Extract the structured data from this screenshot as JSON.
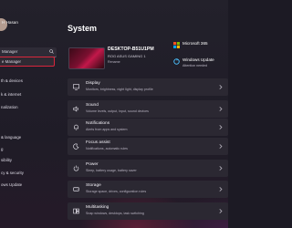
{
  "user": {
    "name": "H Hasan",
    "email": ""
  },
  "search": {
    "value": "Manager"
  },
  "sidebar": {
    "items": [
      {
        "label": "e Manager",
        "active": true
      },
      {
        "label": "th & devices"
      },
      {
        "label": "k & internet"
      },
      {
        "label": "nalization"
      },
      {
        "label": ""
      },
      {
        "label": ""
      },
      {
        "label": "& language"
      },
      {
        "label": "g"
      },
      {
        "label": "sibility"
      },
      {
        "label": "cy & security"
      },
      {
        "label": "ows Update"
      }
    ]
  },
  "main": {
    "title": "System",
    "device": {
      "name": "DESKTOP-B51U1PM",
      "model": "ROG ASUS GAMING 1",
      "rename": "Rename"
    },
    "quick_links": [
      {
        "title": "Microsoft 365",
        "sub": "",
        "icon": "microsoft365-icon"
      },
      {
        "title": "Windows Update",
        "sub": "Attention needed",
        "icon": "windows-update-icon"
      }
    ],
    "cards": [
      {
        "title": "Display",
        "sub": "Monitors, brightness, night light, display profile",
        "icon": "display-icon"
      },
      {
        "title": "Sound",
        "sub": "Volume levels, output, input, sound devices",
        "icon": "sound-icon"
      },
      {
        "title": "Notifications",
        "sub": "Alerts from apps and system",
        "icon": "notifications-icon"
      },
      {
        "title": "Focus assist",
        "sub": "Notifications, automatic rules",
        "icon": "focus-assist-icon"
      },
      {
        "title": "Power",
        "sub": "Sleep, battery usage, battery saver",
        "icon": "power-icon"
      },
      {
        "title": "Storage",
        "sub": "Storage space, drives, configuration rules",
        "icon": "storage-icon"
      },
      {
        "title": "Multitasking",
        "sub": "Snap windows, desktops, task switching",
        "icon": "multitasking-icon"
      }
    ]
  },
  "colors": {
    "accent": "#d9263c",
    "card_bg": "#2b2832",
    "window_bg": "#1f1c27"
  }
}
